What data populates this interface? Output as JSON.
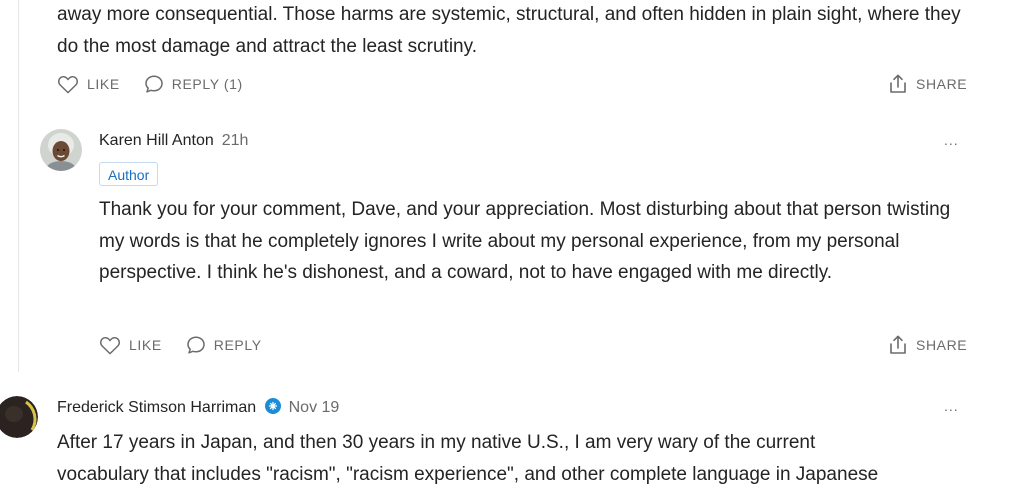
{
  "comment_prev": {
    "text": "away more consequential. Those harms are systemic, structural, and often hidden in plain sight, where they do the most damage and attract the least scrutiny.",
    "like_label": "LIKE",
    "reply_label": "REPLY (1)",
    "share_label": "SHARE"
  },
  "reply": {
    "author": "Karen Hill Anton",
    "time": "21h",
    "badge": "Author",
    "text": "Thank you for your comment, Dave, and your appreciation. Most disturbing about that person twisting my words is that he completely ignores I write about my personal experience, from my personal perspective. I think he's dishonest, and a coward, not to have engaged with me directly.",
    "like_label": "LIKE",
    "reply_label": "REPLY",
    "share_label": "SHARE",
    "more": "..."
  },
  "comment_next": {
    "author": "Frederick Stimson Harriman",
    "time": "Nov 19",
    "more": "...",
    "text": "After 17 years in Japan, and then 30 years in my native U.S., I am very wary of the current",
    "text_cut": "vocabulary that includes \"racism\", \"racism experience\", and other complete language in Japanese"
  },
  "colors": {
    "accent_blue": "#1a6fbf",
    "muted": "#6b6b6b",
    "text": "#242424"
  },
  "icons": [
    "heart-icon",
    "speech-bubble-icon",
    "share-icon",
    "more-icon",
    "member-badge-icon"
  ]
}
